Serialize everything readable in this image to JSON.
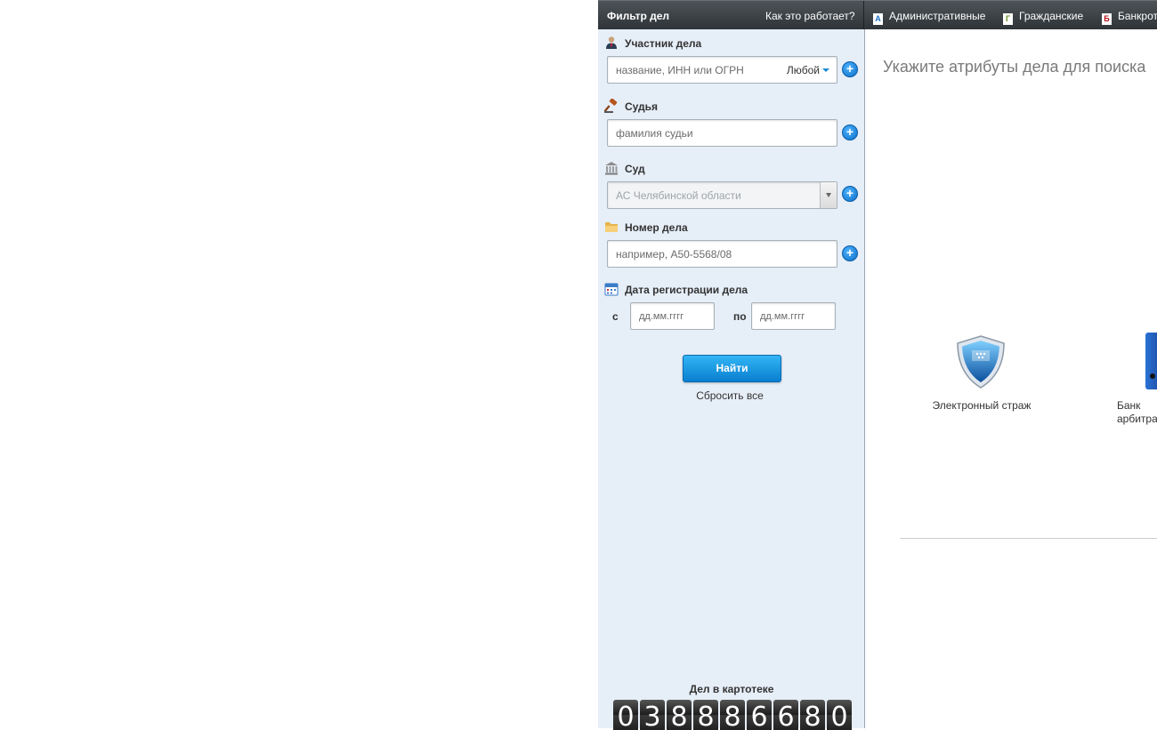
{
  "header": {
    "title": "Фильтр дел",
    "how_it_works": "Как это работает?",
    "tabs": [
      {
        "icon": "A",
        "label": "Административные"
      },
      {
        "icon": "Г",
        "label": "Гражданские"
      },
      {
        "icon": "Б",
        "label": "Банкрот"
      }
    ]
  },
  "filter": {
    "participant": {
      "label": "Участник дела",
      "placeholder": "название, ИНН или ОГРН",
      "mode": "Любой"
    },
    "judge": {
      "label": "Судья",
      "placeholder": "фамилия судьи"
    },
    "court": {
      "label": "Суд",
      "placeholder": "АС Челябинской области"
    },
    "case_number": {
      "label": "Номер дела",
      "placeholder": "например, А50-5568/08"
    },
    "reg_date": {
      "label": "Дата регистрации дела",
      "from_label": "с",
      "to_label": "по",
      "from_placeholder": "дд.мм.гггг",
      "to_placeholder": "дд.мм.гггг"
    },
    "find_button": "Найти",
    "reset_link": "Сбросить все"
  },
  "counter": {
    "label": "Дел в картотеке",
    "digits": [
      "0",
      "3",
      "8",
      "8",
      "8",
      "6",
      "6",
      "8",
      "0"
    ]
  },
  "main": {
    "prompt": "Укажите атрибуты дела для поиска",
    "services": [
      {
        "icon": "shield-icon",
        "label": "Электронный страж"
      },
      {
        "icon": "bank-icon",
        "label_line1": "Банк",
        "label_line2": "арбитра"
      }
    ]
  },
  "colors": {
    "accent": "#1a8bd4",
    "sidebar_bg": "#e6eef8",
    "header_bg": "#3b4044"
  }
}
